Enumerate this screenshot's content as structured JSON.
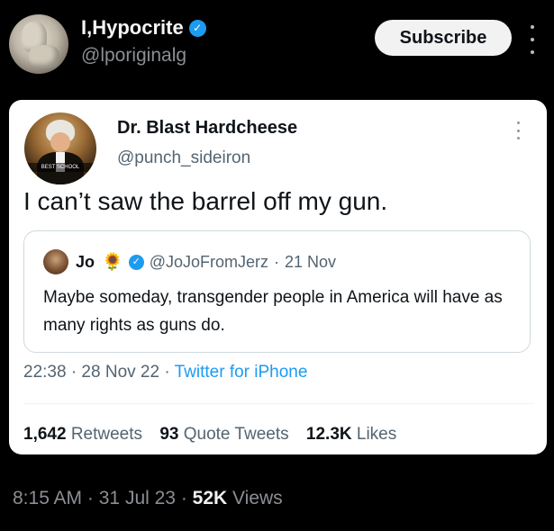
{
  "outer_tweet": {
    "display_name": "I,Hypocrite",
    "handle": "@lporiginalg",
    "subscribe_label": "Subscribe",
    "footer": {
      "time": "8:15 AM",
      "sep1": "·",
      "date": "31 Jul 23",
      "sep2": "·",
      "views_count": "52K",
      "views_label": "Views"
    }
  },
  "embedded_tweet": {
    "display_name": "Dr. Blast Hardcheese",
    "handle": "@punch_sideiron",
    "text": "I can’t saw the barrel off my gun.",
    "avatar_caption": "BEST SCHOOL",
    "quoted": {
      "name": "Jo",
      "emoji": "🌻",
      "handle": "@JoJoFromJerz",
      "sep": "·",
      "date": "21 Nov",
      "text": "Maybe someday, transgender people in America will have as many rights as guns do."
    },
    "timestamp": "22:38 · 28 Nov 22 ·",
    "client": "Twitter for iPhone",
    "stats": [
      {
        "count": "1,642",
        "label": "Retweets"
      },
      {
        "count": "93",
        "label": "Quote Tweets"
      },
      {
        "count": "12.3K",
        "label": "Likes"
      }
    ]
  },
  "icons": {
    "verified": "verified-badge-icon",
    "more": "more-options-icon"
  },
  "colors": {
    "background": "#000000",
    "accent_blue": "#1d9bf0",
    "card": "#ffffff",
    "muted": "#536471"
  }
}
